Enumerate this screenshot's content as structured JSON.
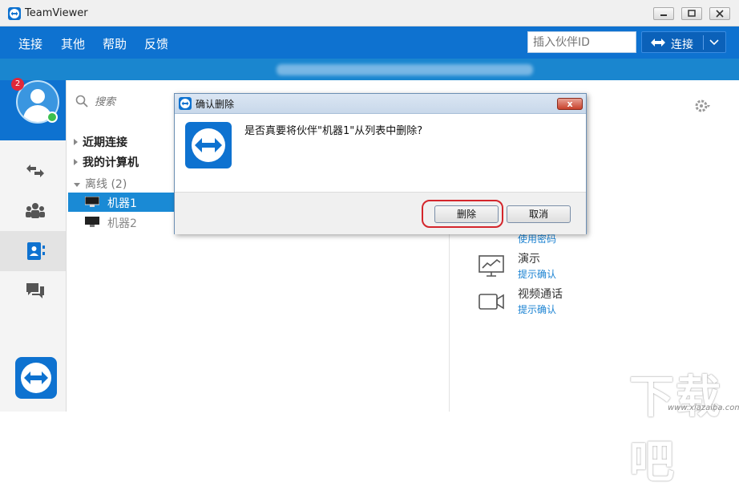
{
  "app": {
    "title": "TeamViewer"
  },
  "menu": {
    "items": [
      "连接",
      "其他",
      "帮助",
      "反馈"
    ]
  },
  "partner": {
    "placeholder": "插入伙伴ID",
    "connect_label": "连接"
  },
  "account": {
    "notification_count": "2",
    "status_color": "#3cc04e"
  },
  "search": {
    "placeholder": "搜索"
  },
  "groups": {
    "recent": "近期连接",
    "my_computers": "我的计算机",
    "offline": "离线 (2)",
    "computers": [
      {
        "name": "机器1",
        "selected": true
      },
      {
        "name": "机器2",
        "selected": false
      }
    ]
  },
  "actions": [
    {
      "sub": "使用密码",
      "icon": "remote-control-icon"
    },
    {
      "title": "演示",
      "sub": "提示确认",
      "icon": "presentation-icon"
    },
    {
      "title": "视频通话",
      "sub": "提示确认",
      "icon": "video-call-icon"
    }
  ],
  "dialog": {
    "title": "确认删除",
    "message": "是否真要将伙伴\"机器1\"从列表中删除?",
    "delete_label": "删除",
    "cancel_label": "取消",
    "close_label": "x"
  },
  "watermark": {
    "text": "下载吧",
    "url": "www.xiazaiba.com"
  },
  "colors": {
    "brand": "#0e72d0",
    "highlight": "#d4262c"
  }
}
